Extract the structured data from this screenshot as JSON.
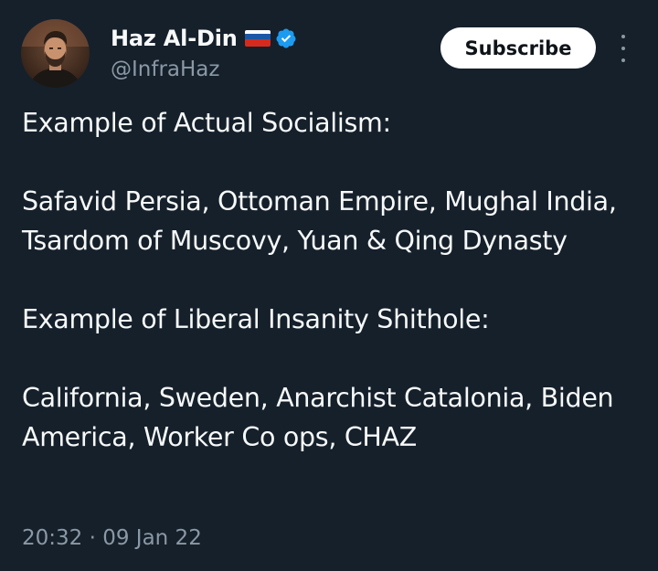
{
  "author": {
    "display_name": "Haz Al-Din",
    "handle": "@InfraHaz",
    "flag_icon": "russia-flag-icon",
    "verified_icon": "verified-badge-icon",
    "verified_color": "#1d9bf0"
  },
  "actions": {
    "subscribe_label": "Subscribe",
    "more_icon": "more-vertical-icon"
  },
  "tweet": {
    "paragraphs": [
      "Example of Actual Socialism:",
      "Safavid Persia, Ottoman Empire, Mughal India, Tsardom of Muscovy, Yuan & Qing Dynasty",
      "Example of Liberal Insanity Shithole:",
      "California, Sweden, Anarchist Catalonia, Biden America, Worker Co ops, CHAZ"
    ],
    "timestamp": "20:32 · 09 Jan 22"
  },
  "colors": {
    "background": "#15202b",
    "text_primary": "#f7f9f9",
    "text_secondary": "#8b98a5",
    "button_bg": "#ffffff",
    "button_text": "#0f1419"
  }
}
